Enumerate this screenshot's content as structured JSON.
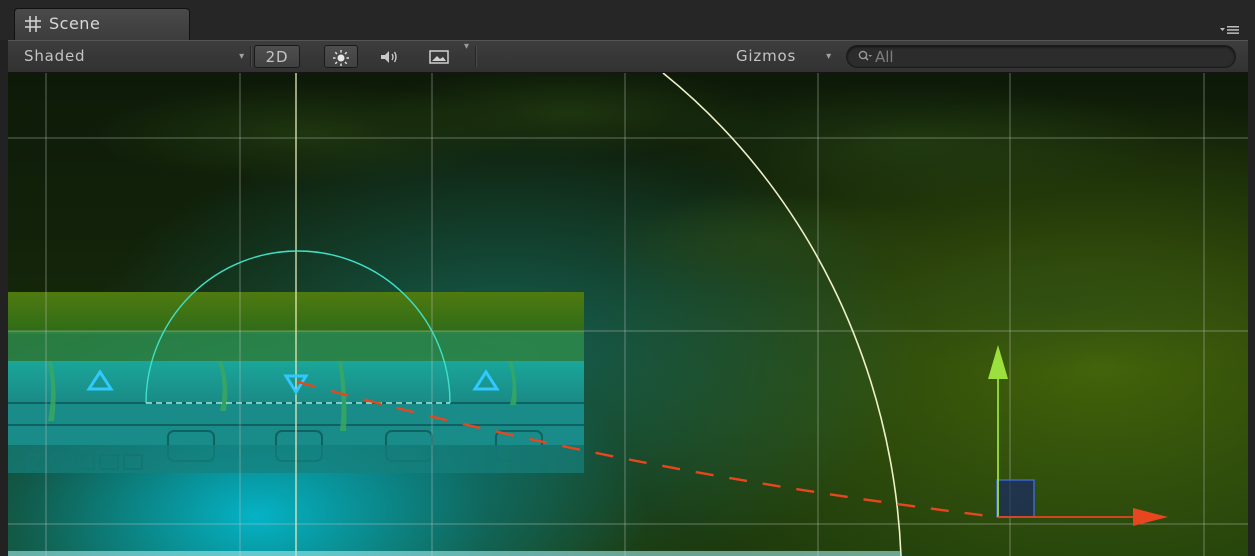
{
  "tab": {
    "title": "Scene",
    "icon": "grid-hash-icon"
  },
  "window_menu_icon": "dropdown-menu-icon",
  "toolbar": {
    "draw_mode": "Shaded",
    "mode_2d_label": "2D",
    "lighting_icon": "sun-icon",
    "audio_icon": "speaker-icon",
    "effects_icon": "image-icon",
    "gizmos_label": "Gizmos",
    "search_placeholder": "All",
    "search_icon": "search-icon"
  },
  "scene": {
    "colors": {
      "grid": "#c8c8c8",
      "cyan_light": "#00c8e6",
      "moss": "#5c820a",
      "x_axis": "#e8461e",
      "y_axis": "#9be03c",
      "arc": "#f0f0c8",
      "light_gizmo": "#40e0c8",
      "marker": "#30c8ff"
    },
    "icons": [
      "move-tool-x-arrow-icon",
      "move-tool-y-arrow-icon",
      "move-tool-plane-handle-icon",
      "spotlight-gizmo-icon",
      "waypoint-marker-icon"
    ]
  }
}
